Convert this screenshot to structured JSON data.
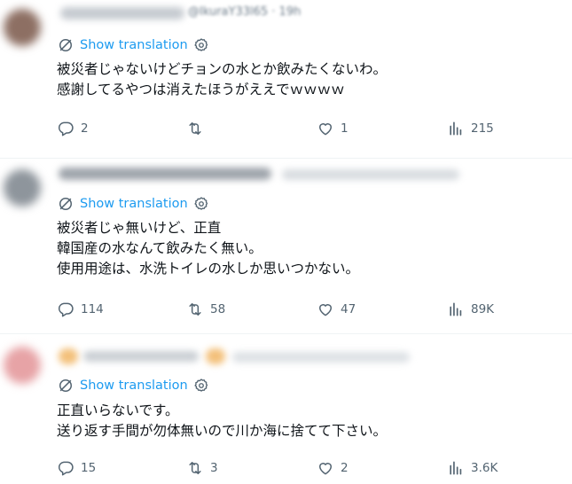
{
  "tweets": [
    {
      "handle": "@IkuraY33l65 · 19h",
      "show_translation": "Show translation",
      "lines": [
        "被災者じゃないけどチョンの水とか飲みたくないわ。",
        "感謝してるやつは消えたほうがええでｗｗｗｗ"
      ],
      "stats": {
        "replies": "2",
        "reposts": "",
        "likes": "1",
        "views": "215"
      }
    },
    {
      "show_translation": "Show translation",
      "lines": [
        "被災者じゃ無いけど、正直",
        "韓国産の水なんて飲みたく無い。",
        "使用用途は、水洗トイレの水しか思いつかない。"
      ],
      "stats": {
        "replies": "114",
        "reposts": "58",
        "likes": "47",
        "views": "89K"
      }
    },
    {
      "show_translation": "Show translation",
      "lines": [
        "正直いらないです。",
        "送り返す手間が勿体無いので川か海に捨てて下さい。"
      ],
      "stats": {
        "replies": "15",
        "reposts": "3",
        "likes": "2",
        "views": "3.6K"
      }
    }
  ],
  "colors": {
    "accent": "#1d9bf0",
    "muted": "#536471",
    "text": "#0f1419",
    "divider": "#eff3f4"
  },
  "icons": [
    "translate-icon",
    "gear-icon",
    "reply-icon",
    "repost-icon",
    "like-icon",
    "views-icon"
  ]
}
